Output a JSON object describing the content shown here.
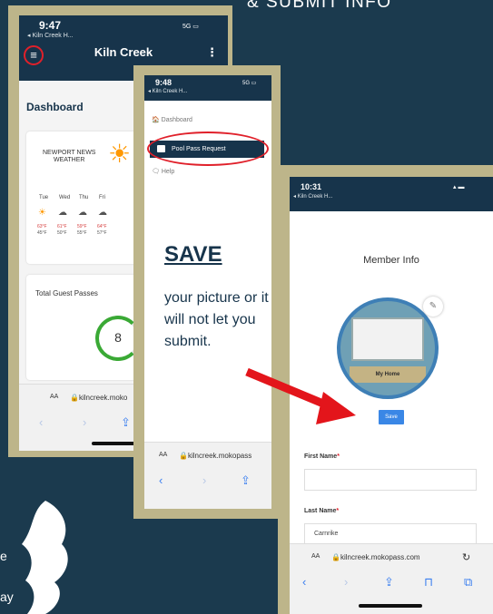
{
  "heading": "& SUBMIT INFO",
  "phone1": {
    "status": {
      "time": "9:47",
      "back": "◂ Kiln Creek H...",
      "signal": "5G"
    },
    "app_title": "Kiln Creek",
    "dashboard": "Dashboard",
    "weather": {
      "title_line1": "NEWPORT NEWS",
      "title_line2": "WEATHER",
      "days": [
        {
          "label": "Tue",
          "hi": "63°F",
          "lo": "45°F"
        },
        {
          "label": "Wed",
          "hi": "61°F",
          "lo": "50°F"
        },
        {
          "label": "Thu",
          "hi": "59°F",
          "lo": "55°F"
        },
        {
          "label": "Fri",
          "hi": "64°F",
          "lo": "57°F"
        }
      ]
    },
    "guest_passes": {
      "title": "Total Guest Passes",
      "value": "8"
    },
    "url": {
      "aa": "AA",
      "text": "kilncreek.moko"
    }
  },
  "phone2": {
    "status": {
      "time": "9:48",
      "back": "◂ Kiln Creek H...",
      "signal": "5G"
    },
    "menu": {
      "dashboard": "Dashboard",
      "pool_pass": "Pool Pass Request",
      "help": "Help"
    },
    "instruction": {
      "title": "SAVE",
      "body": "your picture or it will not let you submit."
    },
    "url": {
      "aa": "AA",
      "text": "kilncreek.mokopass"
    }
  },
  "phone3": {
    "status": {
      "time": "10:31",
      "back": "◂ Kiln Creek H..."
    },
    "section_title": "Member Info",
    "photo_label": "My Home",
    "save_button": "Save",
    "first_name": {
      "label": "First Name",
      "value": ""
    },
    "last_name": {
      "label": "Last Name",
      "value": "Carnrike"
    },
    "url": {
      "aa": "AA",
      "text": "kilncreek.mokopass.com"
    }
  },
  "cut_text": {
    "line1": "e",
    "line2": "ay"
  }
}
